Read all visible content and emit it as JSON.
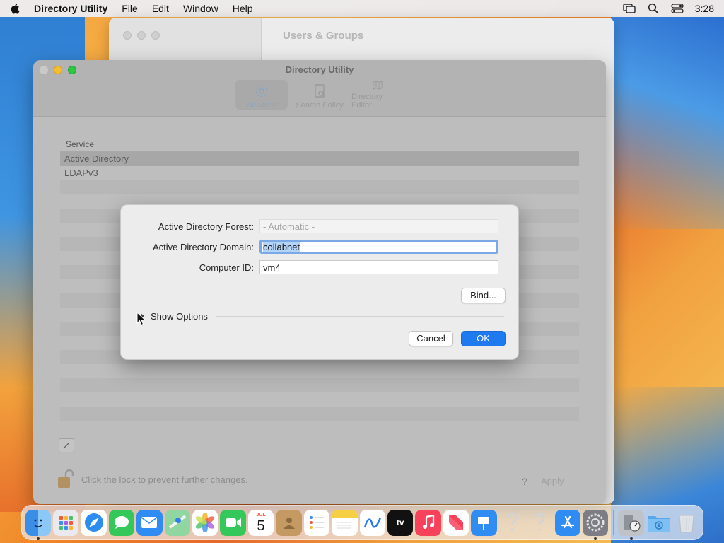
{
  "menubar": {
    "app_name": "Directory Utility",
    "items": [
      "File",
      "Edit",
      "Window",
      "Help"
    ],
    "clock": "3:28"
  },
  "background_window": {
    "title": "Users & Groups"
  },
  "window": {
    "title": "Directory Utility",
    "tabs": [
      {
        "label": "Services",
        "icon": "gear-icon",
        "selected": true
      },
      {
        "label": "Search Policy",
        "icon": "search-policy-icon",
        "selected": false
      },
      {
        "label": "Directory Editor",
        "icon": "map-icon",
        "selected": false
      }
    ],
    "service_table": {
      "header": "Service",
      "rows": [
        "Active Directory",
        "LDAPv3"
      ],
      "selected_index": 0
    },
    "lock_text": "Click the lock to prevent further changes.",
    "help_label": "?",
    "apply_label": "Apply"
  },
  "sheet": {
    "forest_label": "Active Directory Forest:",
    "forest_placeholder": "- Automatic -",
    "domain_label": "Active Directory Domain:",
    "domain_value": "collabnet",
    "computer_id_label": "Computer ID:",
    "computer_id_value": "vm4",
    "bind_label": "Bind...",
    "show_options_label": "Show Options",
    "cancel_label": "Cancel",
    "ok_label": "OK"
  },
  "dock": {
    "calendar_month": "JUL",
    "calendar_day": "5",
    "tv_label": "tv",
    "items": [
      "finder-icon",
      "launchpad-icon",
      "safari-icon",
      "messages-icon",
      "mail-icon",
      "maps-icon",
      "photos-icon",
      "facetime-icon",
      "calendar-icon",
      "contacts-icon",
      "reminders-icon",
      "notes-icon",
      "freeform-icon",
      "apple-tv-icon",
      "music-icon",
      "news-icon",
      "keynote-icon",
      "question-icon",
      "question-icon",
      "app-store-icon",
      "system-settings-icon",
      "directory-utility-icon",
      "downloads-folder-icon",
      "trash-icon"
    ]
  },
  "colors": {
    "accent": "#1f7af0",
    "focus_ring": "#7aa9e6",
    "traffic_min": "#f6be2e",
    "traffic_max": "#2cc840"
  }
}
